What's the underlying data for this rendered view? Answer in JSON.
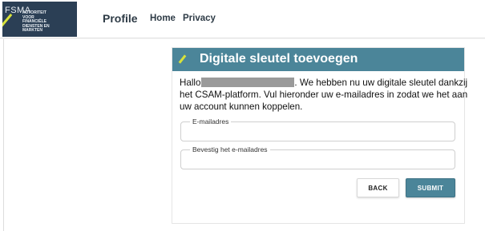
{
  "header": {
    "logo": {
      "acronym": "FSMA",
      "subtitle_lines": [
        "AUTORITEIT",
        "VOOR",
        "FINANCIËLE",
        "DIENSTEN EN",
        "MARKTEN"
      ]
    },
    "brand": "Profile",
    "nav": {
      "home": "Home",
      "privacy": "Privacy"
    }
  },
  "card": {
    "title": "Digitale sleutel toevoegen",
    "intro_prefix": "Hallo",
    "intro_rest": ". We hebben nu uw digitale sleutel dankzij het CSAM-platform. Vul hieronder uw e-mailadres in zodat we het aan uw  account kunnen koppelen.",
    "fields": {
      "email_label": "E-mailadres",
      "email_value": "",
      "confirm_label": "Bevestig het e-mailadres",
      "confirm_value": ""
    },
    "buttons": {
      "back": "BACK",
      "submit": "SUBMIT"
    }
  },
  "colors": {
    "accent": "#4b8599",
    "logo_bg": "#2b3f55",
    "logo_mark": "#d8e23a"
  }
}
